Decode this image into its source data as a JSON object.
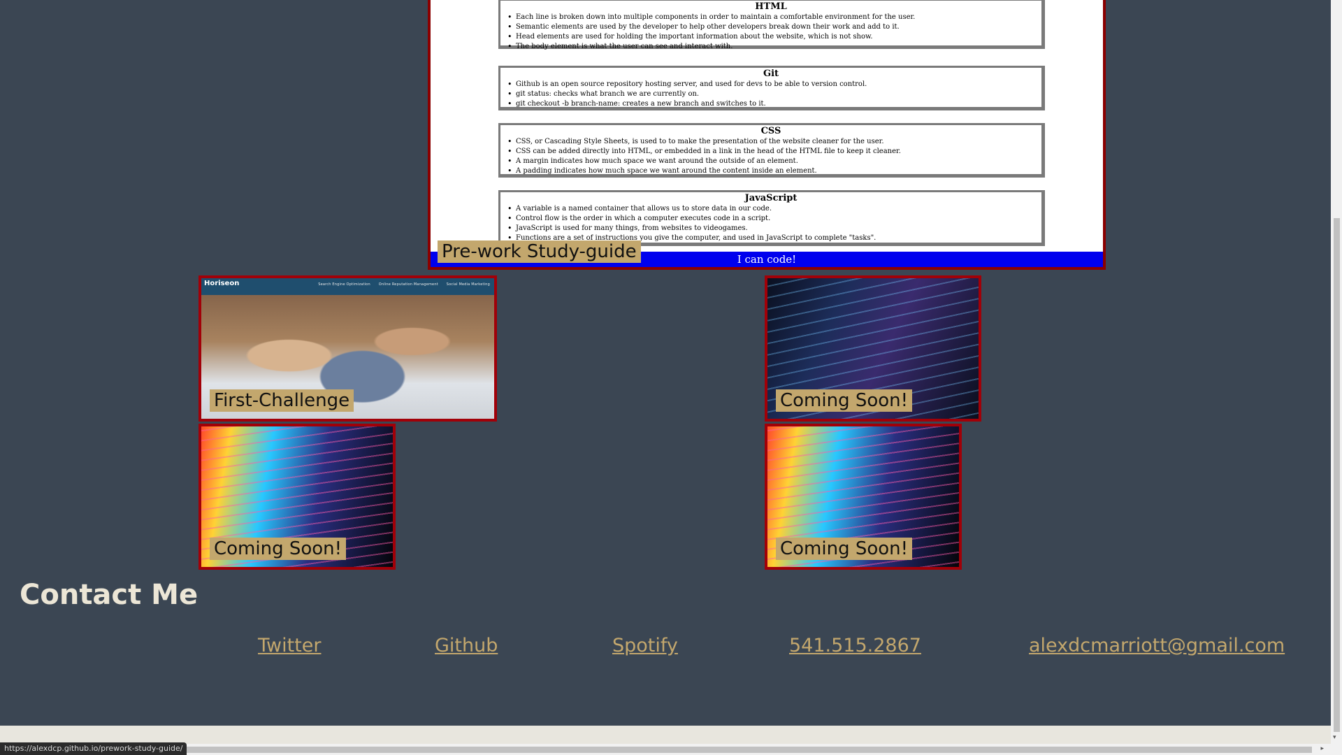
{
  "study_guide": {
    "sections": [
      {
        "title": "HTML",
        "items": [
          "Each line is broken down into multiple components in order to maintain a comfortable environment for the user.",
          "Semantic elements are used by the developer to help other developers break down their work and add to it.",
          "Head elements are used for holding the important information about the website, which is not show.",
          "The body element is what the user can see and interact with."
        ]
      },
      {
        "title": "Git",
        "items": [
          "Github is an open source repository hosting server, and used for devs to be able to version control.",
          "git status: checks what branch we are currently on.",
          "git checkout -b branch-name: creates a new branch and switches to it."
        ]
      },
      {
        "title": "CSS",
        "items": [
          "CSS, or Cascading Style Sheets, is used to to make the presentation of the website cleaner for the user.",
          "CSS can be added directly into HTML, or embedded in a link in the head of the HTML file to keep it cleaner.",
          "A margin indicates how much space we want around the outside of an element.",
          "A padding indicates how much space we want around the content inside an element."
        ]
      },
      {
        "title": "JavaScript",
        "items": [
          "A variable is a named container that allows us to store data in our code.",
          "Control flow is the order in which a computer executes code in a script.",
          "JavaScript is used for many things, from websites to videogames.",
          "Functions are a set of instructions you give the computer, and used in JavaScript to complete \"tasks\"."
        ]
      }
    ],
    "banner": "I can code!",
    "label": "Pre-work Study-guide"
  },
  "projects": {
    "first": {
      "label": "First-Challenge",
      "screenshot_brand": "Horiseon",
      "screenshot_nav": [
        "Search Engine Optimization",
        "Online Reputation Management",
        "Social Media Marketing"
      ]
    },
    "coming_soon_1": "Coming Soon!",
    "coming_soon_2": "Coming Soon!",
    "coming_soon_3": "Coming Soon!"
  },
  "contact": {
    "title": "Contact Me",
    "links": {
      "twitter": "Twitter",
      "github": "Github",
      "spotify": "Spotify",
      "phone": "541.515.2867",
      "email": "alexdcmarriott@gmail.com"
    }
  },
  "browser": {
    "status_url": "https://alexdcp.github.io/prework-study-guide/",
    "scroll_right_glyph": "▸",
    "scroll_down_glyph": "▾"
  },
  "colors": {
    "page_bg": "#3b4653",
    "border_red": "#8b0000",
    "tag_gold": "#c3a76d",
    "banner_blue": "#0000ee",
    "contact_title": "#ece6d6"
  }
}
